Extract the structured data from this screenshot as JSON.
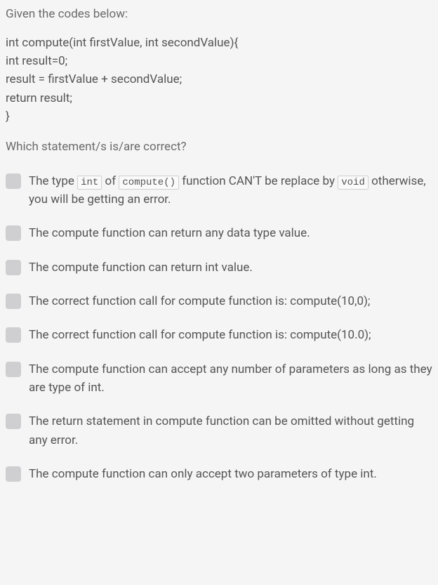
{
  "intro": "Given the codes below:",
  "code_lines": [
    "int compute(int firstValue, int secondValue){",
    "int result=0;",
    "result = firstValue + secondValue;",
    "return result;",
    "}"
  ],
  "prompt": "Which statement/s is/are correct?",
  "options": [
    {
      "pre1": "The type ",
      "code1": "int",
      "mid1": " of ",
      "code2": "compute()",
      "mid2": " function CAN'T be replace by ",
      "code3": "void",
      "post": " otherwise, you will be getting an error."
    },
    {
      "text": "The compute function can return any data type value."
    },
    {
      "text": "The compute function can return int value."
    },
    {
      "text": "The correct function call for compute function is: compute(10,0);"
    },
    {
      "text": "The correct function call for compute function is: compute(10.0);"
    },
    {
      "text": "The compute function can accept any number of parameters as long as they are type of int."
    },
    {
      "text": "The return statement in compute function can be omitted without getting any error."
    },
    {
      "text": "The compute function can only accept two parameters of type int."
    }
  ]
}
